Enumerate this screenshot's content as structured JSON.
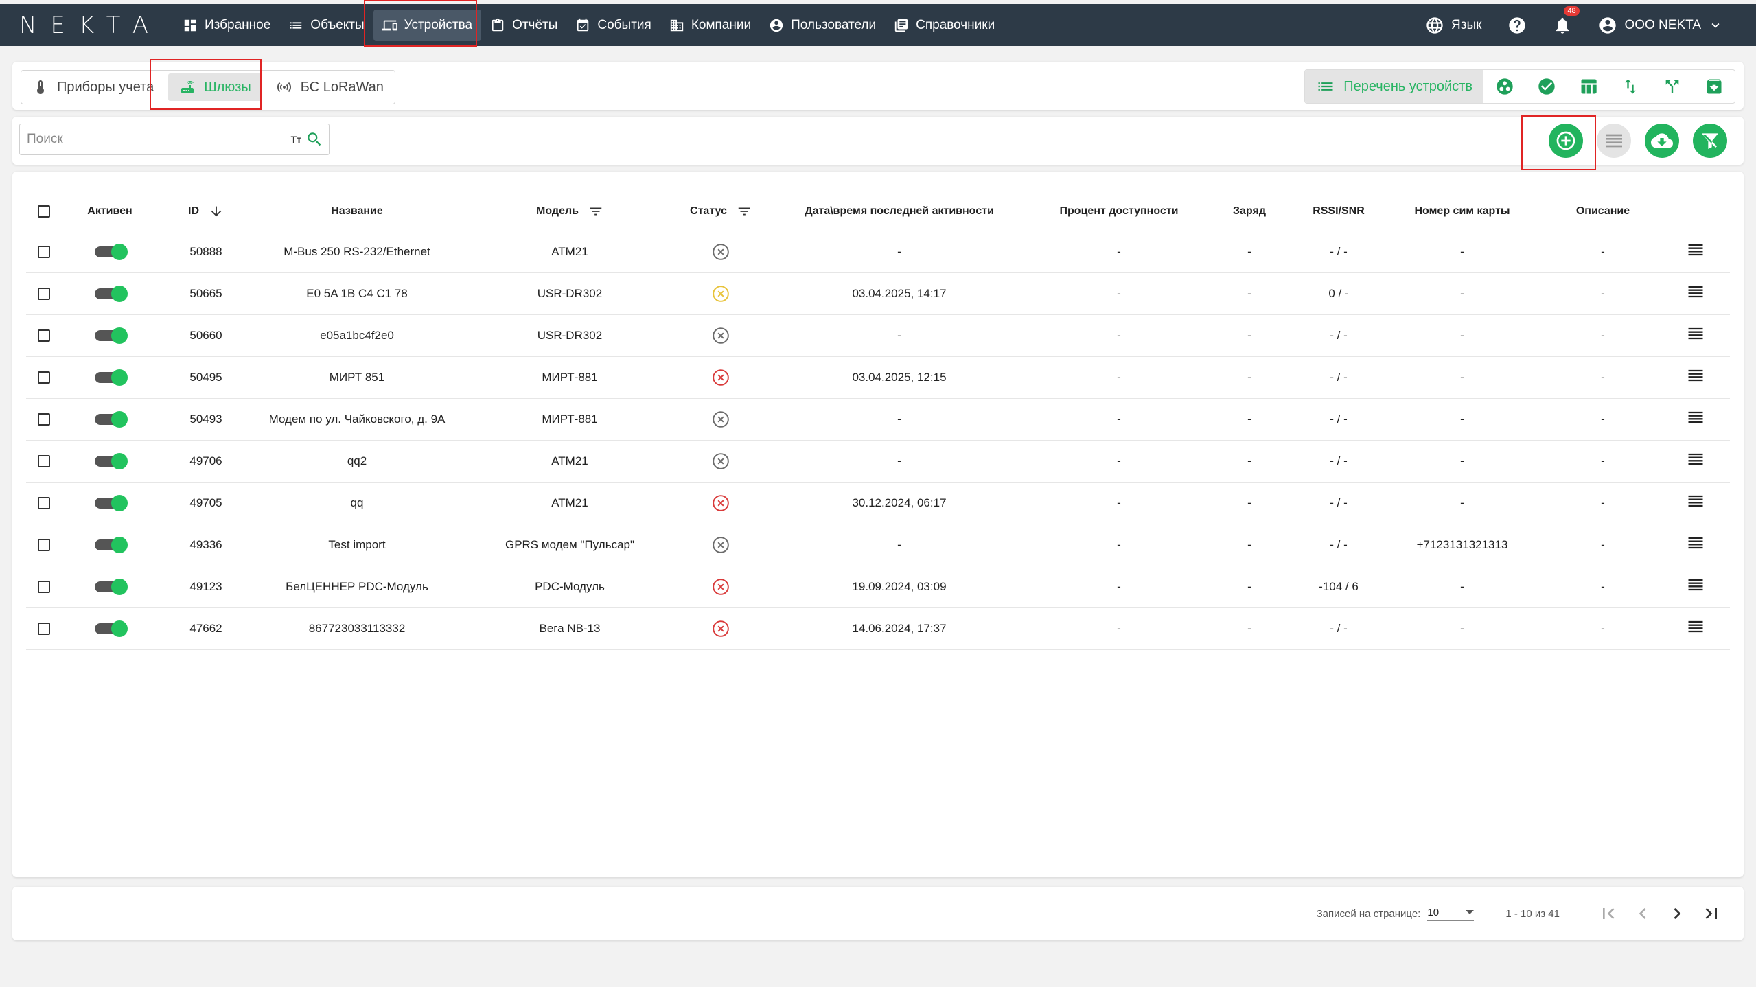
{
  "app": {
    "logo": "NEKTA"
  },
  "nav": {
    "items": [
      {
        "label": "Избранное",
        "icon": "dashboard-icon"
      },
      {
        "label": "Объекты",
        "icon": "list-icon"
      },
      {
        "label": "Устройства",
        "icon": "devices-icon",
        "active": true
      },
      {
        "label": "Отчёты",
        "icon": "clipboard-icon"
      },
      {
        "label": "События",
        "icon": "event-icon"
      },
      {
        "label": "Компании",
        "icon": "building-icon"
      },
      {
        "label": "Пользователи",
        "icon": "user-circle-icon"
      },
      {
        "label": "Справочники",
        "icon": "library-icon"
      }
    ],
    "language": "Язык",
    "notifications_count": "48",
    "account": "ООО NEKTA"
  },
  "device_types": {
    "tabs": [
      {
        "label": "Приборы учета",
        "icon": "thermometer-icon"
      },
      {
        "label": "Шлюзы",
        "icon": "router-icon",
        "active": true
      },
      {
        "label": "БС LoRaWan",
        "icon": "antenna-icon"
      }
    ],
    "view_main_label": "Перечень устройств"
  },
  "search": {
    "placeholder": "Поиск",
    "text_mode": "Tт"
  },
  "table": {
    "headers": {
      "active": "Активен",
      "id": "ID",
      "name": "Название",
      "model": "Модель",
      "status": "Статус",
      "last_activity": "Дата\\время последней активности",
      "availability": "Процент доступности",
      "charge": "Заряд",
      "rssi": "RSSI/SNR",
      "sim": "Номер сим карты",
      "description": "Описание"
    },
    "rows": [
      {
        "id": "50888",
        "name": "M-Bus 250 RS-232/Ethernet",
        "model": "ATM21",
        "status": "offline",
        "last_activity": "-",
        "availability": "-",
        "charge": "-",
        "rssi": "- / -",
        "sim": "-",
        "description": "-"
      },
      {
        "id": "50665",
        "name": "E0 5A 1B C4 C1 78",
        "model": "USR-DR302",
        "status": "warning",
        "last_activity": "03.04.2025, 14:17",
        "availability": "-",
        "charge": "-",
        "rssi": "0 / -",
        "sim": "-",
        "description": "-"
      },
      {
        "id": "50660",
        "name": "e05a1bc4f2e0",
        "model": "USR-DR302",
        "status": "offline",
        "last_activity": "-",
        "availability": "-",
        "charge": "-",
        "rssi": "- / -",
        "sim": "-",
        "description": "-"
      },
      {
        "id": "50495",
        "name": "МИРТ 851",
        "model": "МИРТ-881",
        "status": "error",
        "last_activity": "03.04.2025, 12:15",
        "availability": "-",
        "charge": "-",
        "rssi": "- / -",
        "sim": "-",
        "description": "-"
      },
      {
        "id": "50493",
        "name": "Модем по ул. Чайковского, д. 9А",
        "model": "МИРТ-881",
        "status": "offline",
        "last_activity": "-",
        "availability": "-",
        "charge": "-",
        "rssi": "- / -",
        "sim": "-",
        "description": "-"
      },
      {
        "id": "49706",
        "name": "qq2",
        "model": "ATM21",
        "status": "offline",
        "last_activity": "-",
        "availability": "-",
        "charge": "-",
        "rssi": "- / -",
        "sim": "-",
        "description": "-"
      },
      {
        "id": "49705",
        "name": "qq",
        "model": "ATM21",
        "status": "error",
        "last_activity": "30.12.2024, 06:17",
        "availability": "-",
        "charge": "-",
        "rssi": "- / -",
        "sim": "-",
        "description": "-"
      },
      {
        "id": "49336",
        "name": "Test import",
        "model": "GPRS модем \"Пульсар\"",
        "status": "offline",
        "last_activity": "-",
        "availability": "-",
        "charge": "-",
        "rssi": "- / -",
        "sim": "+7123131321313",
        "description": "-"
      },
      {
        "id": "49123",
        "name": "БелЦЕННЕР PDC-Модуль",
        "model": "PDC-Модуль",
        "status": "error",
        "last_activity": "19.09.2024, 03:09",
        "availability": "-",
        "charge": "-",
        "rssi": "-104 / 6",
        "sim": "-",
        "description": "-"
      },
      {
        "id": "47662",
        "name": "867723033113332",
        "model": "Вега NB-13",
        "status": "error",
        "last_activity": "14.06.2024, 17:37",
        "availability": "-",
        "charge": "-",
        "rssi": "- / -",
        "sim": "-",
        "description": "-"
      }
    ]
  },
  "pagination": {
    "per_page_label": "Записей на странице:",
    "per_page_value": "10",
    "range": "1 - 10 из 41"
  },
  "colors": {
    "nav_bg": "#2d3a47",
    "accent": "#22b45e",
    "status_offline": "#6b6b6b",
    "status_warning": "#e8c33a",
    "status_error": "#d93a3a",
    "highlight": "#e02424"
  }
}
